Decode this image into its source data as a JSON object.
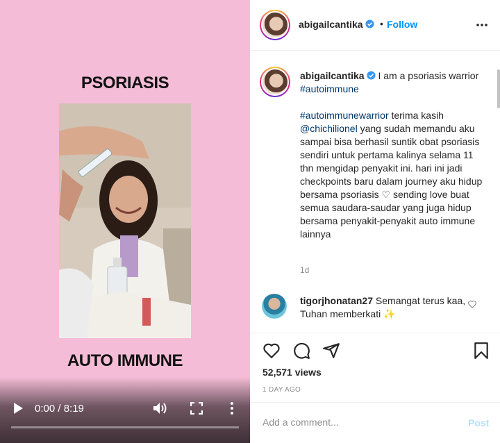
{
  "video": {
    "title_top": "PSORIASIS",
    "title_bottom": "AUTO IMMUNE",
    "time": "0:00 / 8:19",
    "progress": 0.0
  },
  "header": {
    "username": "abigailcantika",
    "separator": "•",
    "follow_label": "Follow"
  },
  "caption": {
    "username": "abigailcantika",
    "line1_text": "I am a psoriasis warrior",
    "line1_tag": "#autoimmune",
    "para_tag": "#autoimmunewarrior",
    "para_text1": "terima kasih",
    "mention": "@chichilionel",
    "para_text2": "yang sudah memandu aku sampai bisa berhasil suntik obat psoriasis sendiri untuk pertama kalinya selama 11 thn mengidap penyakit ini. hari ini jadi checkpoints baru dalam journey aku hidup bersama psoriasis",
    "heart": "♡",
    "para_text3": "sending love buat semua saudara-saudar yang juga hidup bersama penyakit-penyakit auto immune lainnya",
    "age": "1d"
  },
  "comment": {
    "username": "tigorjhonatan27",
    "text": "Semangat terus kaa, Tuhan memberkati",
    "emoji": "✨"
  },
  "stats": {
    "views": "52,571 views",
    "when": "1 DAY AGO"
  },
  "compose": {
    "placeholder": "Add a comment...",
    "post_label": "Post"
  },
  "colors": {
    "media_bg": "#f4bcd6",
    "link_blue": "#0095f6",
    "hashtag": "#00376b",
    "post_disabled": "#b2dffc"
  }
}
